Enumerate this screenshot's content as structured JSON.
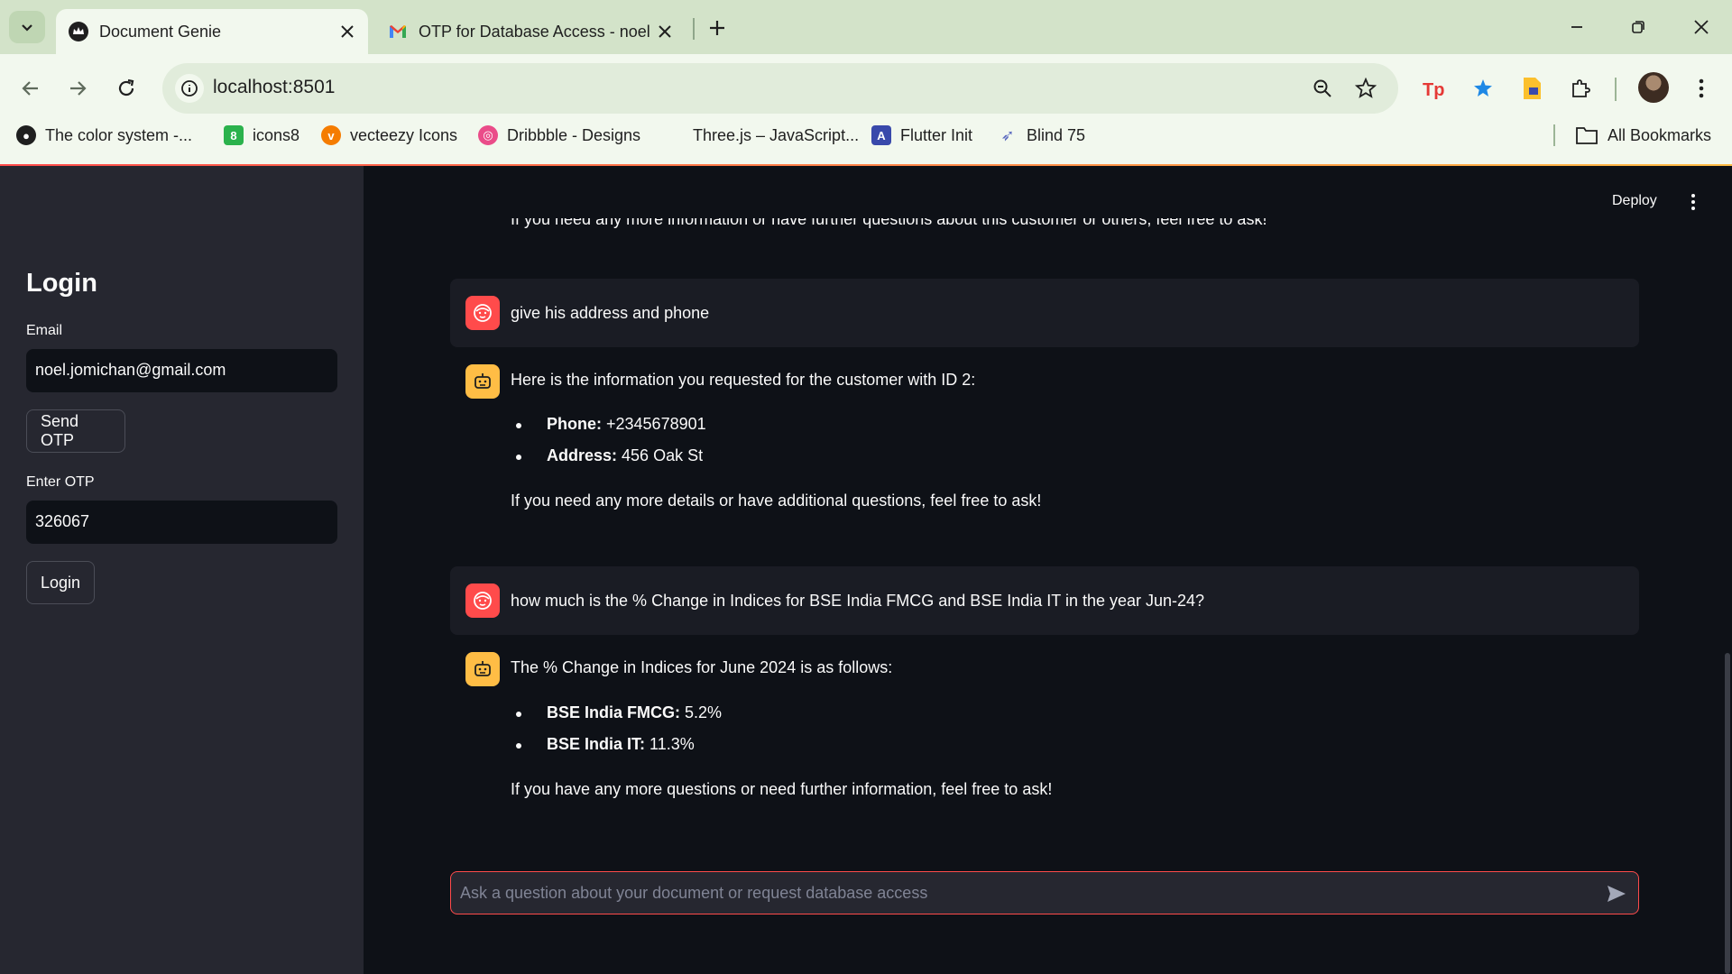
{
  "browser": {
    "tabs": [
      {
        "title": "Document Genie",
        "active": true
      },
      {
        "title": "OTP for Database Access - noel",
        "active": false
      }
    ],
    "url": "localhost:8501",
    "bookmarks": [
      {
        "label": "The color system -...",
        "icon": "github-icon"
      },
      {
        "label": "icons8",
        "icon": "icons8-icon"
      },
      {
        "label": "vecteezy Icons",
        "icon": "vecteezy-icon"
      },
      {
        "label": "Dribbble - Designs",
        "icon": "dribbble-icon"
      },
      {
        "label": "Three.js – JavaScript...",
        "icon": "threejs-icon"
      },
      {
        "label": "Flutter Init",
        "icon": "flutter-icon"
      },
      {
        "label": "Blind 75",
        "icon": "rocket-icon"
      }
    ],
    "all_bookmarks": "All Bookmarks"
  },
  "sidebar": {
    "title": "Login",
    "email_label": "Email",
    "email_value": "noel.jomichan@gmail.com",
    "send_otp_label": "Send OTP",
    "otp_label": "Enter OTP",
    "otp_value": "326067",
    "login_label": "Login"
  },
  "header": {
    "deploy_label": "Deploy"
  },
  "chat": {
    "cut_off_text": "If you need any more information or have further questions about this customer or others, feel free to ask!",
    "messages": [
      {
        "role": "user",
        "text": "give his address and phone"
      },
      {
        "role": "assistant",
        "intro": "Here is the information you requested for the customer with ID 2:",
        "bullets": [
          {
            "key": "Phone:",
            "value": " +2345678901"
          },
          {
            "key": "Address:",
            "value": " 456 Oak St"
          }
        ],
        "outro": "If you need any more details or have additional questions, feel free to ask!"
      },
      {
        "role": "user",
        "text": "how much is the % Change in Indices for BSE India FMCG and BSE India IT in the year Jun-24?"
      },
      {
        "role": "assistant",
        "intro": "The % Change in Indices for June 2024 is as follows:",
        "bullets": [
          {
            "key": "BSE India FMCG:",
            "value": " 5.2%"
          },
          {
            "key": "BSE India IT:",
            "value": " 11.3%"
          }
        ],
        "outro": "If you have any more questions or need further information, feel free to ask!"
      }
    ],
    "input_placeholder": "Ask a question about your document or request database access"
  },
  "colors": {
    "accent": "#ff4b4b",
    "bot_avatar": "#ffbd45",
    "background": "#0e1117",
    "sidebar": "#262730"
  }
}
